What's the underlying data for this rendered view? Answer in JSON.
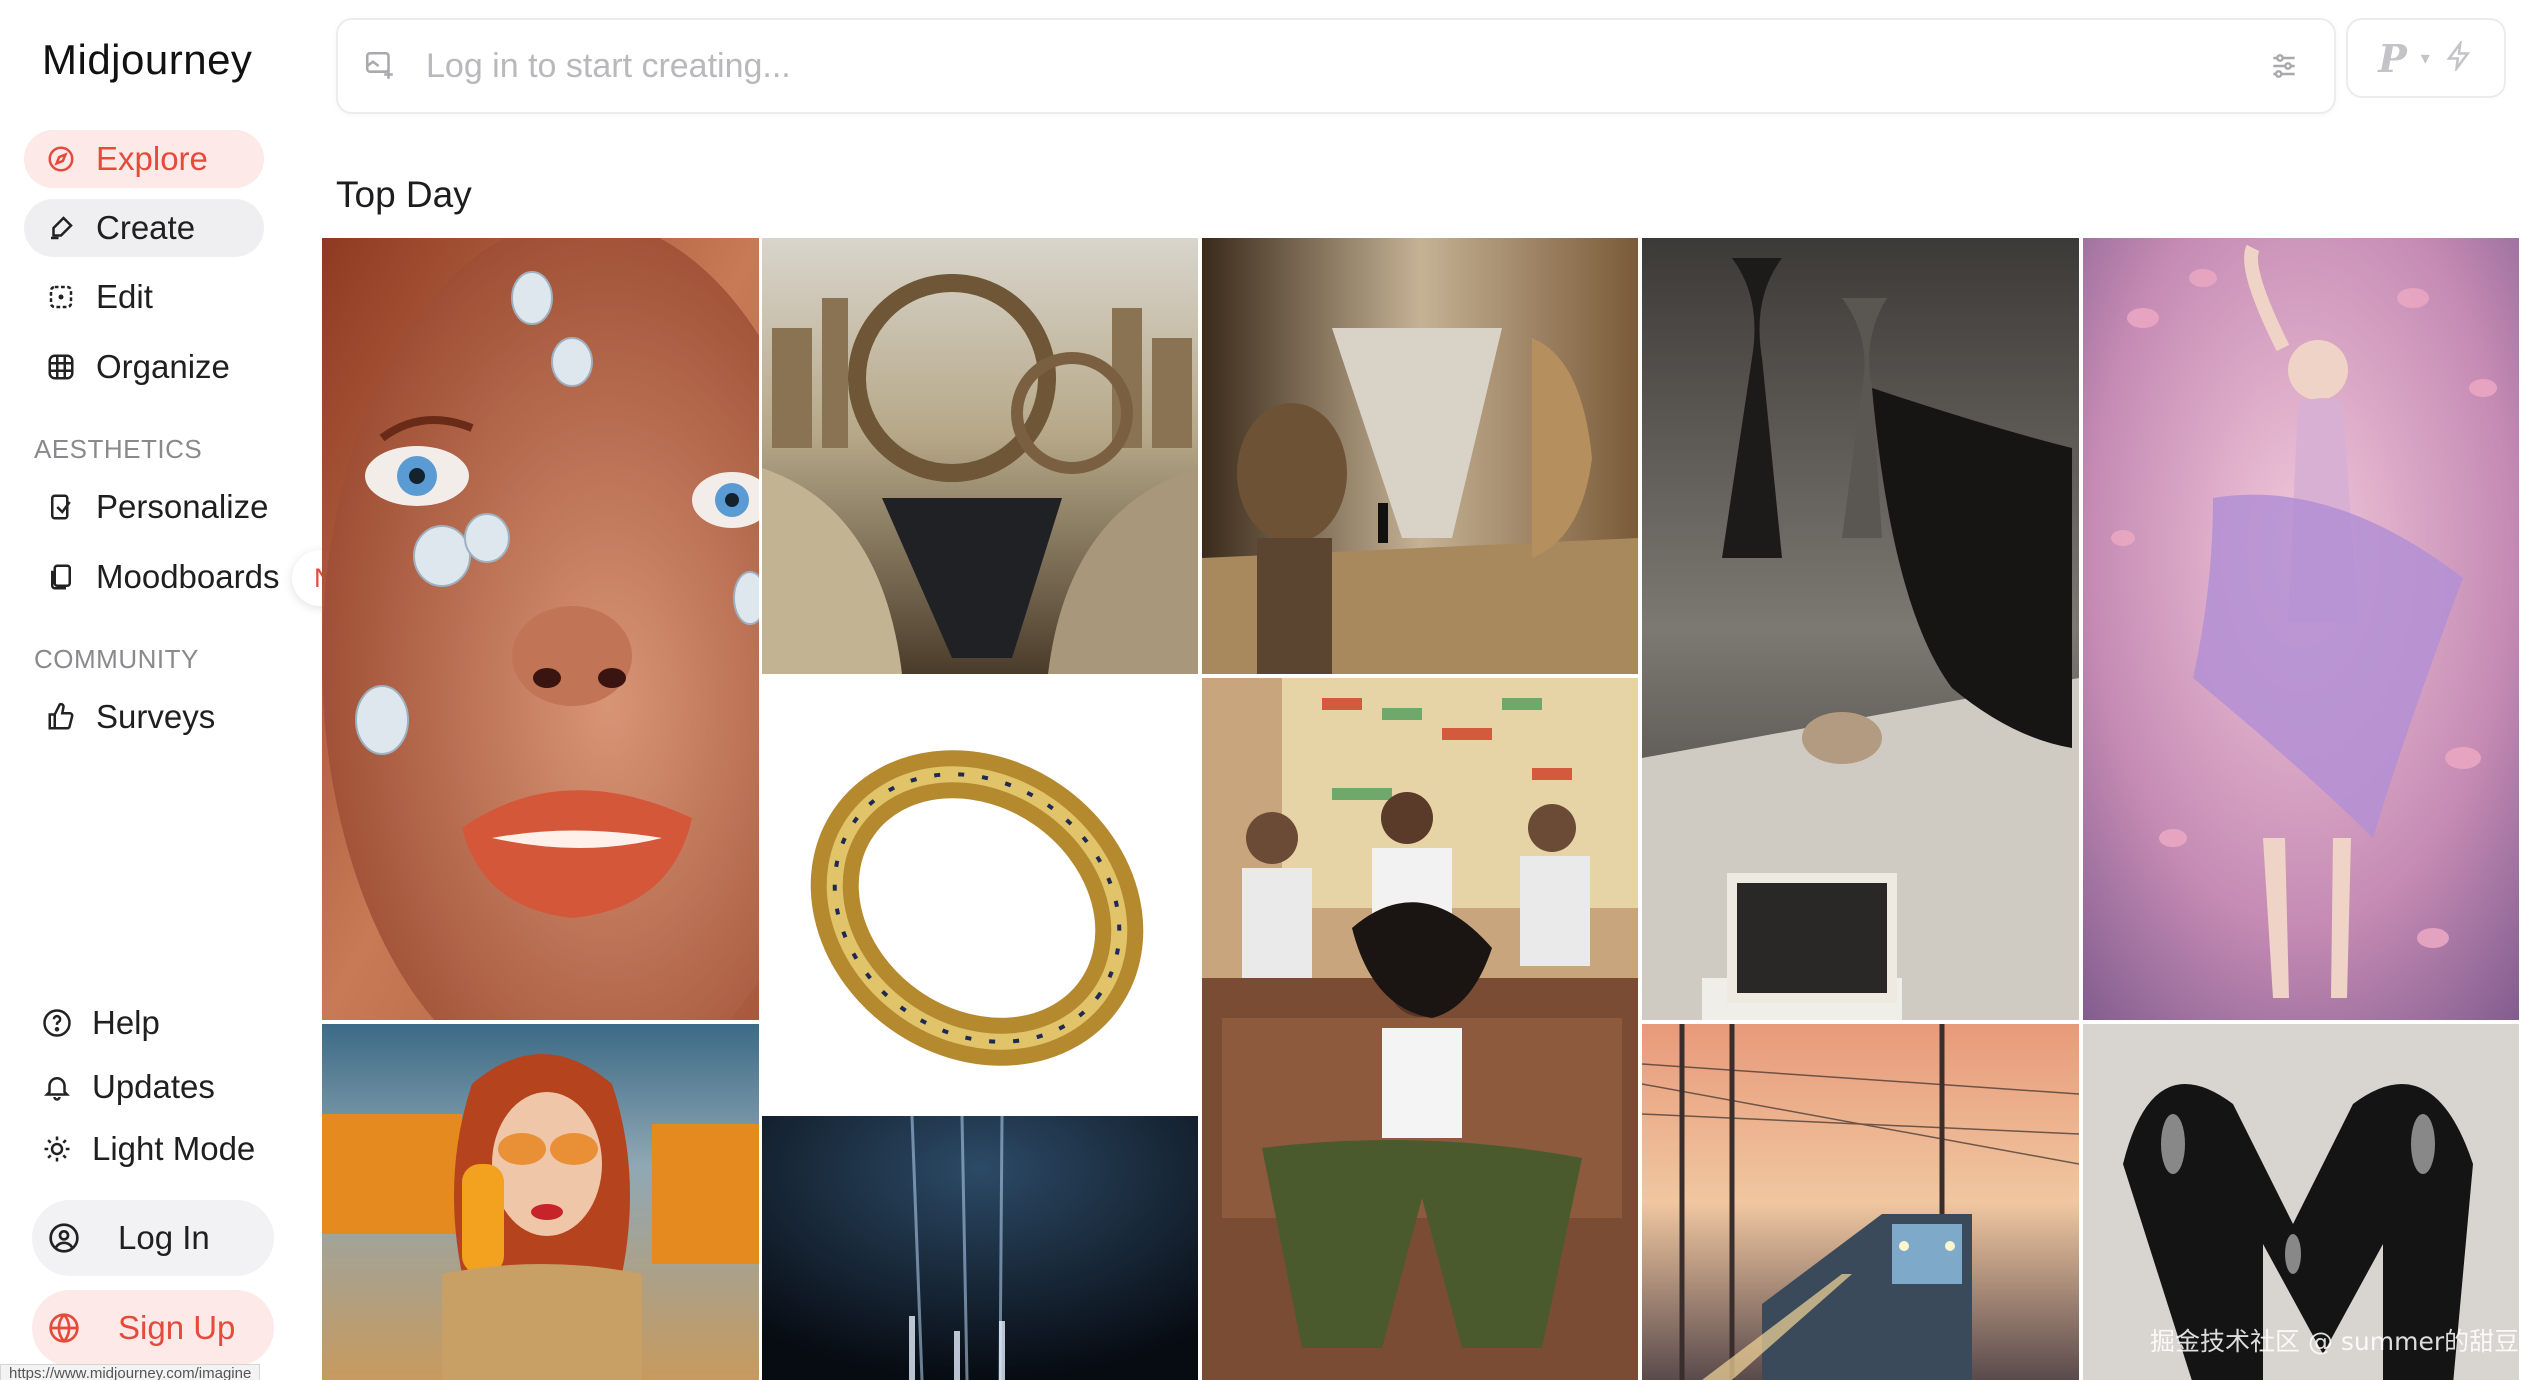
{
  "brand": "Midjourney",
  "nav": {
    "explore": "Explore",
    "create": "Create",
    "edit": "Edit",
    "organize": "Organize",
    "aesthetics_label": "AESTHETICS",
    "personalize": "Personalize",
    "moodboards": "Moodboards",
    "new_badge": "New!",
    "community_label": "COMMUNITY",
    "surveys": "Surveys"
  },
  "footer_nav": {
    "help": "Help",
    "updates": "Updates",
    "light_mode": "Light Mode",
    "log_in": "Log In",
    "sign_up": "Sign Up"
  },
  "status_url": "https://www.midjourney.com/imagine",
  "search": {
    "placeholder": "Log in to start creating..."
  },
  "mode": {
    "label": "P"
  },
  "section_title": "Top Day",
  "gallery": [
    {
      "name": "freckled-face-with-crystals"
    },
    {
      "name": "golden-fantasy-canal-city"
    },
    {
      "name": "museum-sculpture-hall"
    },
    {
      "name": "fashion-designer-sketching"
    },
    {
      "name": "pink-ballerina-petals"
    },
    {
      "name": "golden-jeweled-bangle"
    },
    {
      "name": "comic-woman-on-sofa"
    },
    {
      "name": "redhead-with-orange-popsicle"
    },
    {
      "name": "dark-light-beams"
    },
    {
      "name": "train-at-sunset"
    },
    {
      "name": "black-balloon-letter"
    }
  ],
  "watermark": "掘金技术社区 @ summer的甜豆",
  "colors": {
    "accent": "#e54a3a",
    "accent_bg": "#fde9e7",
    "pill_bg": "#efeff1"
  }
}
